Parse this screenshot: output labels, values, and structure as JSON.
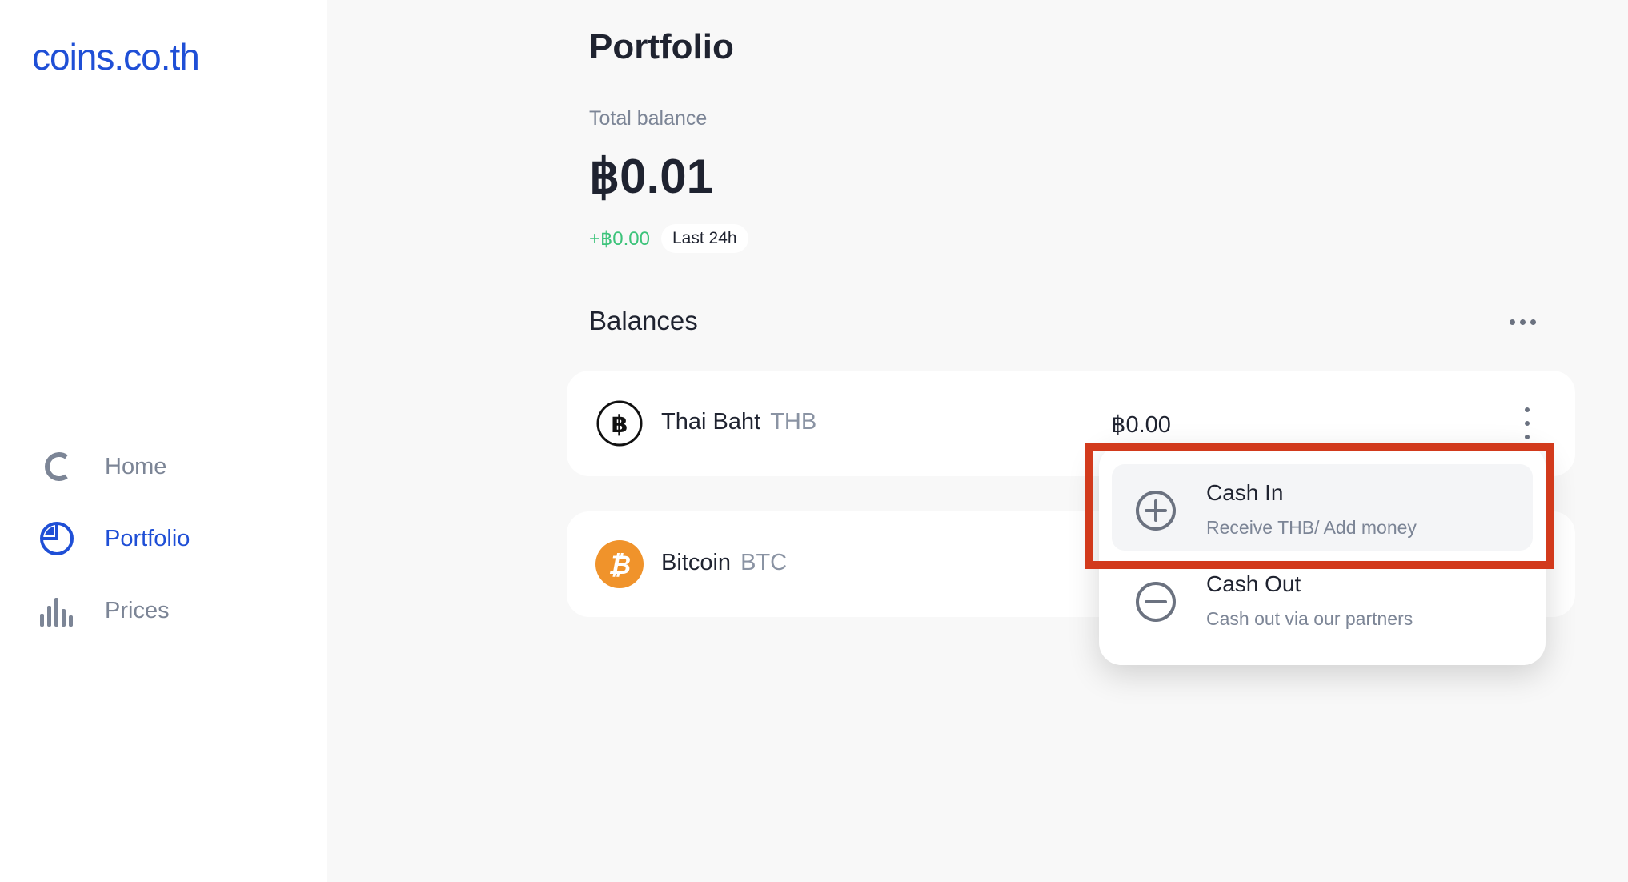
{
  "app": {
    "logo_text": "coins.co.th",
    "brand_color": "#1f4fd6"
  },
  "sidebar": {
    "items": [
      {
        "label": "Home",
        "icon": "home-c-icon",
        "active": false
      },
      {
        "label": "Portfolio",
        "icon": "pie-chart-icon",
        "active": true
      },
      {
        "label": "Prices",
        "icon": "bar-chart-icon",
        "active": false
      }
    ]
  },
  "main": {
    "title": "Portfolio",
    "total_label": "Total balance",
    "total_value": "฿0.01",
    "change_value": "+฿0.00",
    "change_period": "Last 24h",
    "balances_title": "Balances",
    "balances": [
      {
        "name": "Thai Baht",
        "ticker": "THB",
        "amount": "฿0.00",
        "icon": "thb-coin-icon"
      },
      {
        "name": "Bitcoin",
        "ticker": "BTC",
        "amount": "",
        "icon": "btc-coin-icon"
      }
    ]
  },
  "dropdown": {
    "items": [
      {
        "title": "Cash In",
        "subtitle": "Receive THB/ Add money",
        "icon": "plus-circle-icon"
      },
      {
        "title": "Cash Out",
        "subtitle": "Cash out via our partners",
        "icon": "minus-circle-icon"
      }
    ]
  },
  "colors": {
    "positive": "#3cc37a",
    "highlight": "#d23a1c",
    "btc": "#f0932b"
  }
}
